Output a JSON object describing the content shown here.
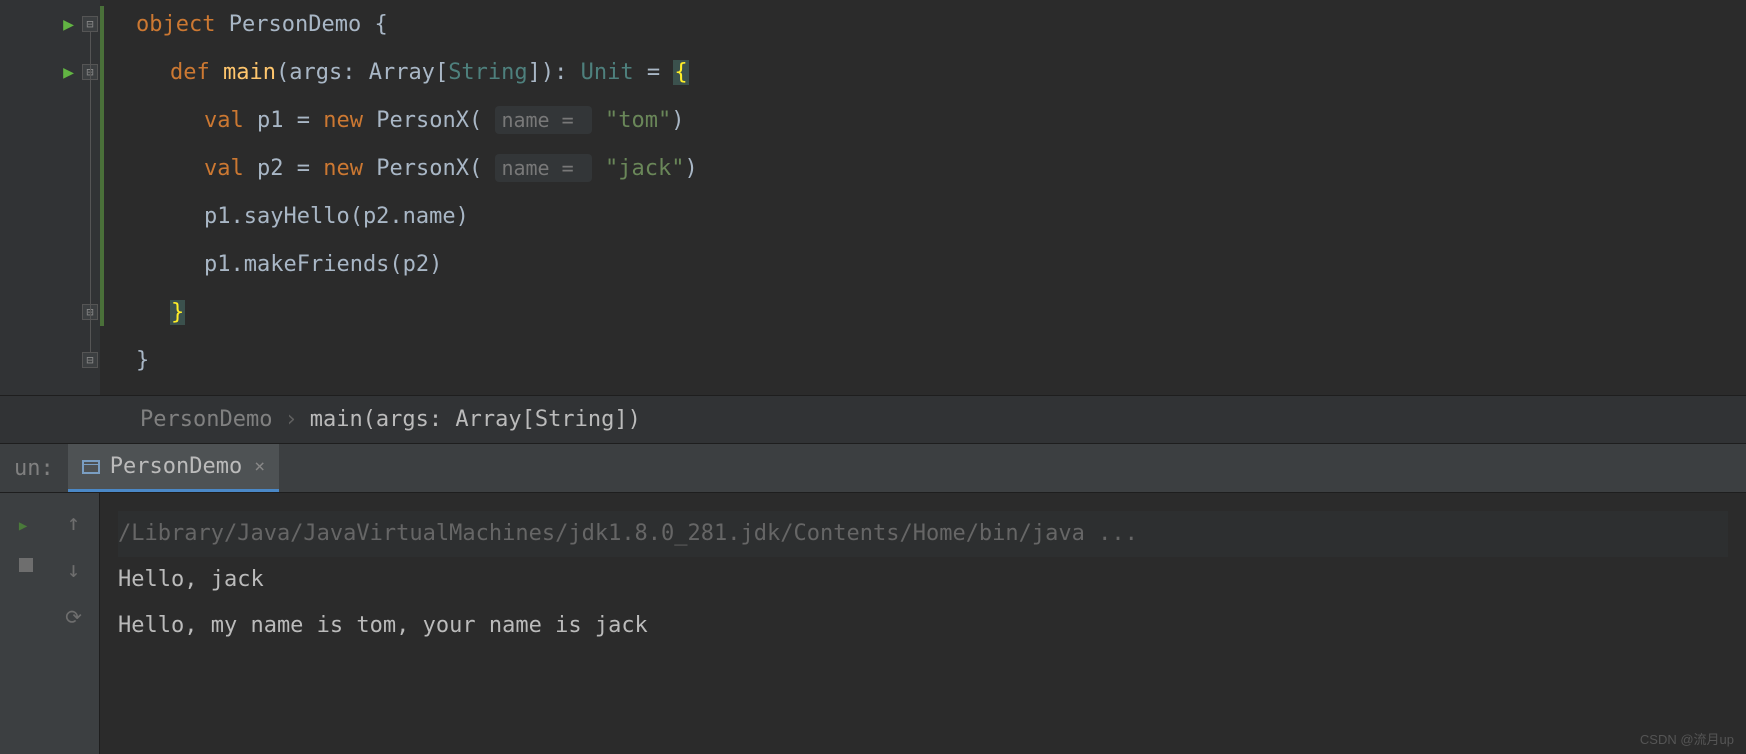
{
  "code": {
    "line1": {
      "kw": "object",
      "name": "PersonDemo",
      "brace": "{"
    },
    "line2": {
      "kw": "def",
      "fn": "main",
      "sig1": "(args: ",
      "type": "Array",
      "sig2": "[",
      "typeArg": "String",
      "sig3": "]): ",
      "ret": "Unit",
      "eq": " = ",
      "brace": "{"
    },
    "line3": {
      "kw": "val",
      "txt1": " p1 = ",
      "new": "new",
      "txt2": " PersonX( ",
      "hint": "name = ",
      "str": "\"tom\"",
      "txt3": ")"
    },
    "line4": {
      "kw": "val",
      "txt1": " p2 = ",
      "new": "new",
      "txt2": " PersonX( ",
      "hint": "name = ",
      "str": "\"jack\"",
      "txt3": ")"
    },
    "line5": {
      "txt": "p1.sayHello(p2.name)"
    },
    "line6": {
      "txt": "p1.makeFriends(p2)"
    },
    "line7": {
      "brace": "}"
    },
    "line8": {
      "brace": "}"
    }
  },
  "breadcrumb": {
    "item1": "PersonDemo",
    "sep": "›",
    "item2": "main(args: Array[String])"
  },
  "runPanel": {
    "label": "un:",
    "tabName": "PersonDemo",
    "close": "×"
  },
  "console": {
    "cmd": "/Library/Java/JavaVirtualMachines/jdk1.8.0_281.jdk/Contents/Home/bin/java ...",
    "out1": "Hello, jack",
    "out2": "Hello, my name is tom, your name is jack"
  },
  "watermark": "CSDN @流月up"
}
